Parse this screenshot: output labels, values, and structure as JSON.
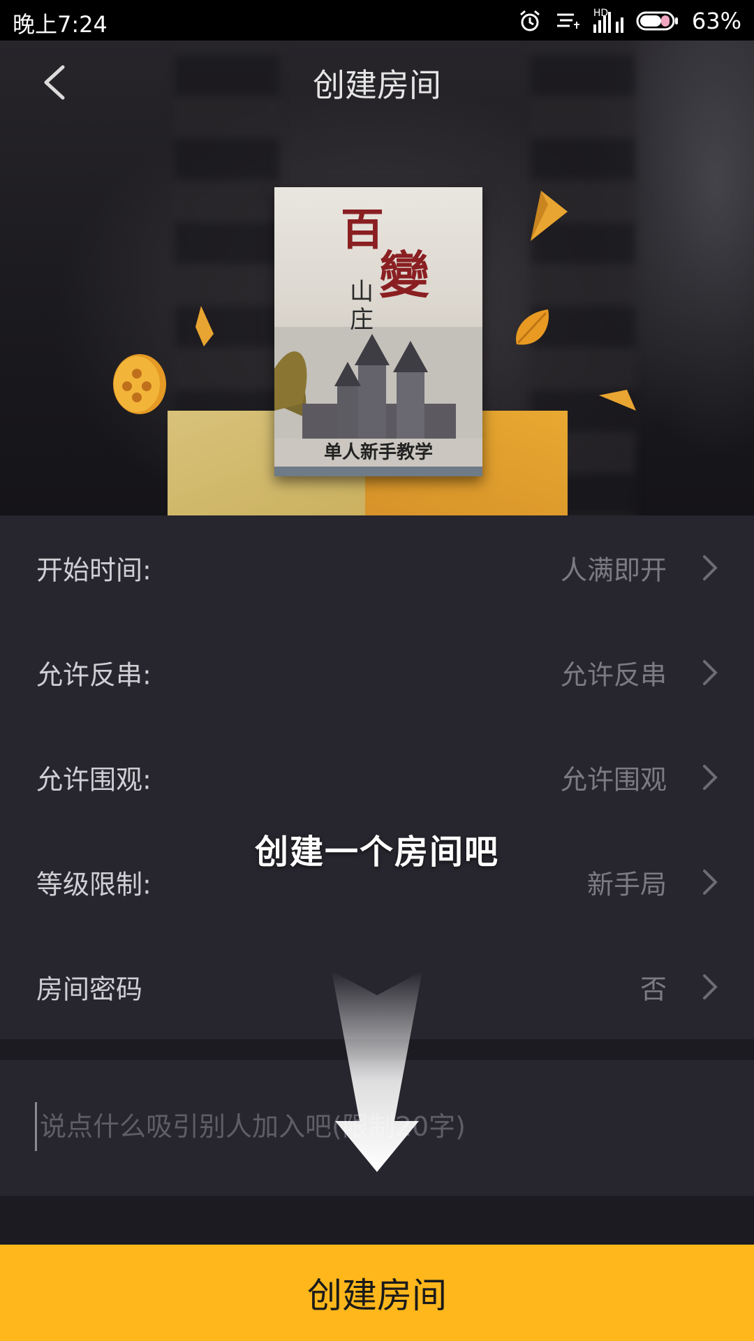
{
  "status_bar": {
    "time": "晚上7:24",
    "network": "HD",
    "battery_percent": "63%",
    "icons": [
      "alarm-icon",
      "notification-icon",
      "signal-icon",
      "battery-icon"
    ]
  },
  "header": {
    "title": "创建房间",
    "back_icon": "back-chevron-icon"
  },
  "hero": {
    "book_title_char1": "百",
    "book_title_char2": "變",
    "book_subtitle": "山庄",
    "book_band": "单人新手教学"
  },
  "settings": [
    {
      "label": "开始时间:",
      "value": "人满即开"
    },
    {
      "label": "允许反串:",
      "value": "允许反串"
    },
    {
      "label": "允许围观:",
      "value": "允许围观"
    },
    {
      "label": "等级限制:",
      "value": "新手局"
    },
    {
      "label": "房间密码",
      "value": "否"
    }
  ],
  "overlay": {
    "hint": "创建一个房间吧"
  },
  "description": {
    "placeholder": "说点什么吸引别人加入吧(限制20字)",
    "value": ""
  },
  "footer": {
    "create_label": "创建房间"
  },
  "colors": {
    "accent": "#ffb71b",
    "background": "#1c1b22",
    "panel": "#27262e"
  }
}
